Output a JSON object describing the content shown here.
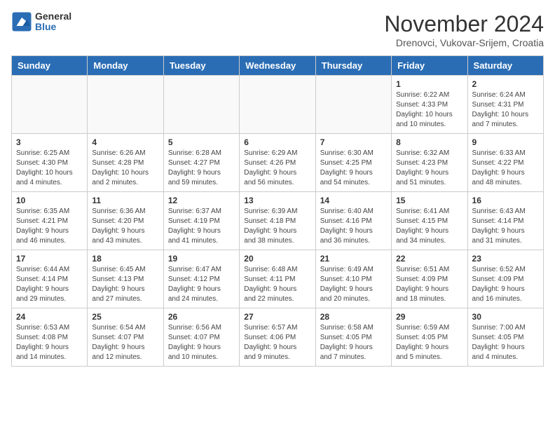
{
  "logo": {
    "general": "General",
    "blue": "Blue"
  },
  "header": {
    "month": "November 2024",
    "location": "Drenovci, Vukovar-Srijem, Croatia"
  },
  "weekdays": [
    "Sunday",
    "Monday",
    "Tuesday",
    "Wednesday",
    "Thursday",
    "Friday",
    "Saturday"
  ],
  "weeks": [
    [
      {
        "day": "",
        "info": ""
      },
      {
        "day": "",
        "info": ""
      },
      {
        "day": "",
        "info": ""
      },
      {
        "day": "",
        "info": ""
      },
      {
        "day": "",
        "info": ""
      },
      {
        "day": "1",
        "info": "Sunrise: 6:22 AM\nSunset: 4:33 PM\nDaylight: 10 hours\nand 10 minutes."
      },
      {
        "day": "2",
        "info": "Sunrise: 6:24 AM\nSunset: 4:31 PM\nDaylight: 10 hours\nand 7 minutes."
      }
    ],
    [
      {
        "day": "3",
        "info": "Sunrise: 6:25 AM\nSunset: 4:30 PM\nDaylight: 10 hours\nand 4 minutes."
      },
      {
        "day": "4",
        "info": "Sunrise: 6:26 AM\nSunset: 4:28 PM\nDaylight: 10 hours\nand 2 minutes."
      },
      {
        "day": "5",
        "info": "Sunrise: 6:28 AM\nSunset: 4:27 PM\nDaylight: 9 hours\nand 59 minutes."
      },
      {
        "day": "6",
        "info": "Sunrise: 6:29 AM\nSunset: 4:26 PM\nDaylight: 9 hours\nand 56 minutes."
      },
      {
        "day": "7",
        "info": "Sunrise: 6:30 AM\nSunset: 4:25 PM\nDaylight: 9 hours\nand 54 minutes."
      },
      {
        "day": "8",
        "info": "Sunrise: 6:32 AM\nSunset: 4:23 PM\nDaylight: 9 hours\nand 51 minutes."
      },
      {
        "day": "9",
        "info": "Sunrise: 6:33 AM\nSunset: 4:22 PM\nDaylight: 9 hours\nand 48 minutes."
      }
    ],
    [
      {
        "day": "10",
        "info": "Sunrise: 6:35 AM\nSunset: 4:21 PM\nDaylight: 9 hours\nand 46 minutes."
      },
      {
        "day": "11",
        "info": "Sunrise: 6:36 AM\nSunset: 4:20 PM\nDaylight: 9 hours\nand 43 minutes."
      },
      {
        "day": "12",
        "info": "Sunrise: 6:37 AM\nSunset: 4:19 PM\nDaylight: 9 hours\nand 41 minutes."
      },
      {
        "day": "13",
        "info": "Sunrise: 6:39 AM\nSunset: 4:18 PM\nDaylight: 9 hours\nand 38 minutes."
      },
      {
        "day": "14",
        "info": "Sunrise: 6:40 AM\nSunset: 4:16 PM\nDaylight: 9 hours\nand 36 minutes."
      },
      {
        "day": "15",
        "info": "Sunrise: 6:41 AM\nSunset: 4:15 PM\nDaylight: 9 hours\nand 34 minutes."
      },
      {
        "day": "16",
        "info": "Sunrise: 6:43 AM\nSunset: 4:14 PM\nDaylight: 9 hours\nand 31 minutes."
      }
    ],
    [
      {
        "day": "17",
        "info": "Sunrise: 6:44 AM\nSunset: 4:14 PM\nDaylight: 9 hours\nand 29 minutes."
      },
      {
        "day": "18",
        "info": "Sunrise: 6:45 AM\nSunset: 4:13 PM\nDaylight: 9 hours\nand 27 minutes."
      },
      {
        "day": "19",
        "info": "Sunrise: 6:47 AM\nSunset: 4:12 PM\nDaylight: 9 hours\nand 24 minutes."
      },
      {
        "day": "20",
        "info": "Sunrise: 6:48 AM\nSunset: 4:11 PM\nDaylight: 9 hours\nand 22 minutes."
      },
      {
        "day": "21",
        "info": "Sunrise: 6:49 AM\nSunset: 4:10 PM\nDaylight: 9 hours\nand 20 minutes."
      },
      {
        "day": "22",
        "info": "Sunrise: 6:51 AM\nSunset: 4:09 PM\nDaylight: 9 hours\nand 18 minutes."
      },
      {
        "day": "23",
        "info": "Sunrise: 6:52 AM\nSunset: 4:09 PM\nDaylight: 9 hours\nand 16 minutes."
      }
    ],
    [
      {
        "day": "24",
        "info": "Sunrise: 6:53 AM\nSunset: 4:08 PM\nDaylight: 9 hours\nand 14 minutes."
      },
      {
        "day": "25",
        "info": "Sunrise: 6:54 AM\nSunset: 4:07 PM\nDaylight: 9 hours\nand 12 minutes."
      },
      {
        "day": "26",
        "info": "Sunrise: 6:56 AM\nSunset: 4:07 PM\nDaylight: 9 hours\nand 10 minutes."
      },
      {
        "day": "27",
        "info": "Sunrise: 6:57 AM\nSunset: 4:06 PM\nDaylight: 9 hours\nand 9 minutes."
      },
      {
        "day": "28",
        "info": "Sunrise: 6:58 AM\nSunset: 4:05 PM\nDaylight: 9 hours\nand 7 minutes."
      },
      {
        "day": "29",
        "info": "Sunrise: 6:59 AM\nSunset: 4:05 PM\nDaylight: 9 hours\nand 5 minutes."
      },
      {
        "day": "30",
        "info": "Sunrise: 7:00 AM\nSunset: 4:05 PM\nDaylight: 9 hours\nand 4 minutes."
      }
    ]
  ]
}
